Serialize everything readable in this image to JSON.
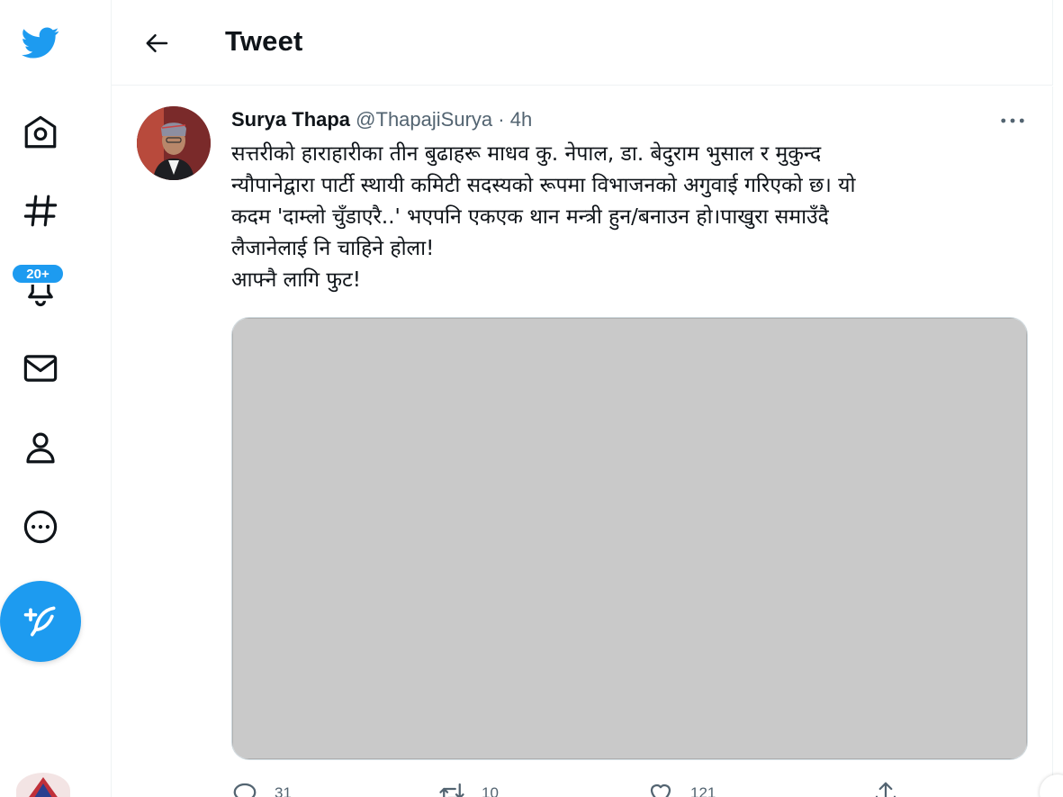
{
  "nav": {
    "items": [
      {
        "icon": "twitter-logo-icon"
      },
      {
        "icon": "home-icon"
      },
      {
        "icon": "explore-hashtag-icon"
      },
      {
        "icon": "notifications-bell-icon",
        "badge": "20+"
      },
      {
        "icon": "messages-envelope-icon"
      },
      {
        "icon": "profile-icon"
      },
      {
        "icon": "more-circle-icon"
      }
    ],
    "compose_icon": "compose-feather-icon",
    "brand_color": "#1d9bf0"
  },
  "header": {
    "title": "Tweet",
    "back_icon": "arrow-left-icon"
  },
  "tweet": {
    "author_name": "Surya Thapa",
    "handle": "@ThapajiSurya",
    "separator": "·",
    "time": "4h",
    "text_lines": [
      "सत्तरीको हाराहारीका तीन बुढाहरू माधव कु. नेपाल, डा. बेदुराम भुसाल र मुकुन्द",
      "न्यौपानेद्वारा पार्टी स्थायी कमिटी सदस्यको रूपमा विभाजनको अगुवाई गरिएको छ। यो",
      "कदम 'दाम्लो चुँडाएरै..' भएपनि एकएक थान मन्त्री हुन/बनाउन हो।पाखुरा समाउँदै",
      "लैजानेलाई नि चाहिने होला!",
      "आफ्नै लागि फुट!"
    ],
    "actions": {
      "reply_count": "31",
      "retweet_count": "10",
      "like_count": "121"
    }
  }
}
